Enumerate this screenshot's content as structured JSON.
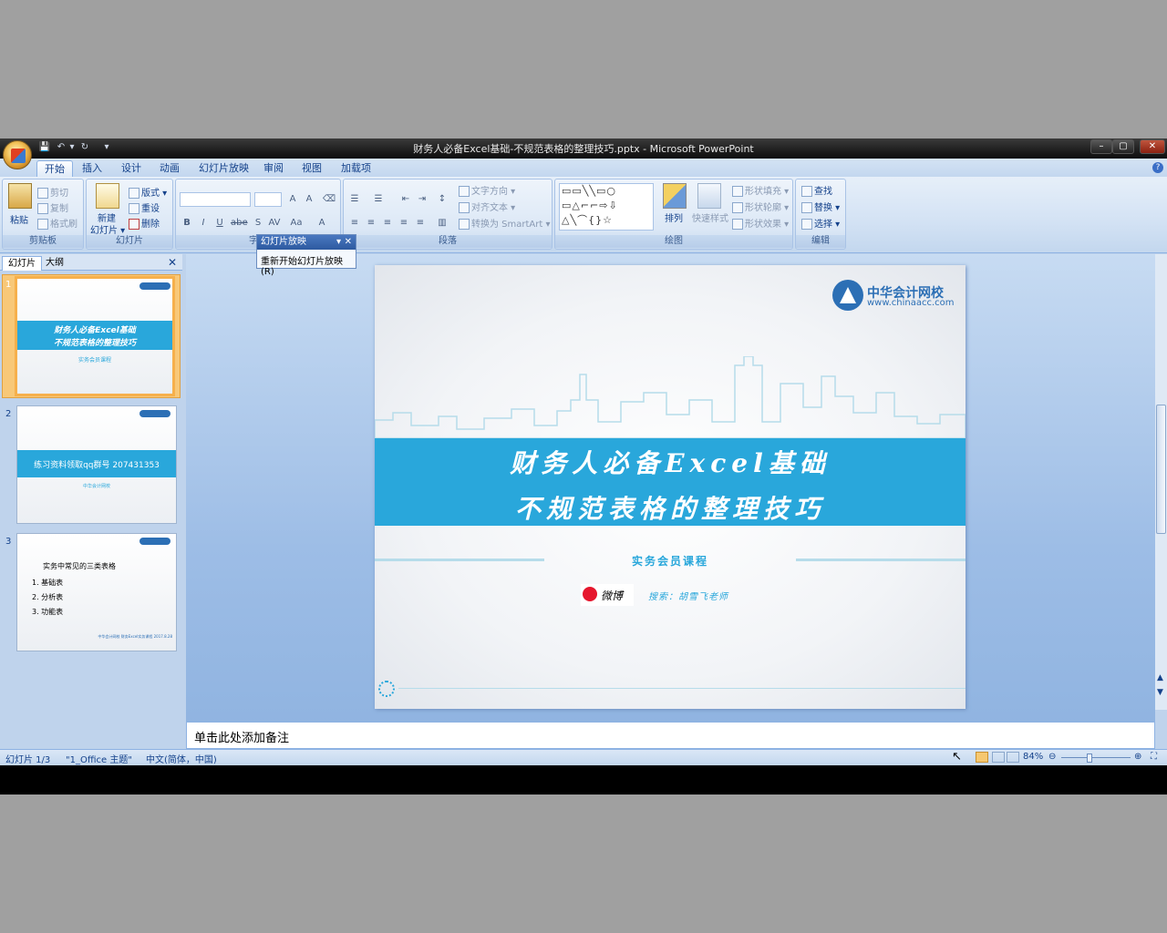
{
  "window": {
    "title": "财务人必备Excel基础-不规范表格的整理技巧.pptx - Microsoft PowerPoint",
    "min": "–",
    "max": "▢",
    "close": "✕"
  },
  "tabs": [
    "开始",
    "插入",
    "设计",
    "动画",
    "幻灯片放映",
    "审阅",
    "视图",
    "加载项"
  ],
  "ribbon": {
    "clipboard": {
      "paste": "粘贴",
      "cut": "剪切",
      "copy": "复制",
      "format_painter": "格式刷",
      "label": "剪贴板"
    },
    "slides": {
      "new_slide": "新建\n幻灯片",
      "new_slide_line1": "新建",
      "new_slide_line2": "幻灯片 ▾",
      "layout": "版式 ▾",
      "reset": "重设",
      "delete": "删除",
      "label": "幻灯片"
    },
    "font": {
      "label": "字体"
    },
    "paragraph": {
      "text_direction": "文字方向 ▾",
      "align_text": "对齐文本 ▾",
      "convert_smartart": "转换为 SmartArt ▾",
      "label": "段落"
    },
    "drawing": {
      "arrange": "排列",
      "quick_styles": "快速样式",
      "shape_fill": "形状填充 ▾",
      "shape_outline": "形状轮廓 ▾",
      "shape_effects": "形状效果 ▾",
      "label": "绘图"
    },
    "editing": {
      "find": "查找",
      "replace": "替换 ▾",
      "select": "选择 ▾",
      "label": "编辑"
    }
  },
  "popup": {
    "title": "幻灯片放映",
    "item": "重新开始幻灯片放映(R)"
  },
  "left_pane": {
    "tab_slides": "幻灯片",
    "tab_outline": "大纲",
    "thumbs": [
      {
        "num": "1",
        "line1": "财务人必备Excel基础",
        "line2": "不规范表格的整理技巧",
        "sub": "实务会员课程"
      },
      {
        "num": "2",
        "text": "练习资料领取qq群号 207431353",
        "sub": "中华会计网校"
      },
      {
        "num": "3",
        "title": "实务中常见的三类表格",
        "items": [
          "1. 基础表",
          "2. 分析表",
          "3. 功能表"
        ],
        "footer": "中华会计网校 财务Excel实务课程 2017.8.28"
      }
    ]
  },
  "slide": {
    "logo_name": "中华会计网校",
    "logo_url": "www.chinaacc.com",
    "title_line1": "财务人必备Excel基础",
    "title_line2": "不规范表格的整理技巧",
    "subtitle": "实务会员课程",
    "weibo": "微博",
    "search_text": "搜索：胡雪飞老师"
  },
  "notes_placeholder": "单击此处添加备注",
  "status": {
    "slide_pos": "幻灯片 1/3",
    "theme": "\"1_Office 主题\"",
    "language": "中文(简体，中国)",
    "zoom": "84%"
  },
  "colors": {
    "banner": "#29a7db",
    "accent_orange": "#f6b04c",
    "ribbon_bg": "#d3e2f4"
  }
}
